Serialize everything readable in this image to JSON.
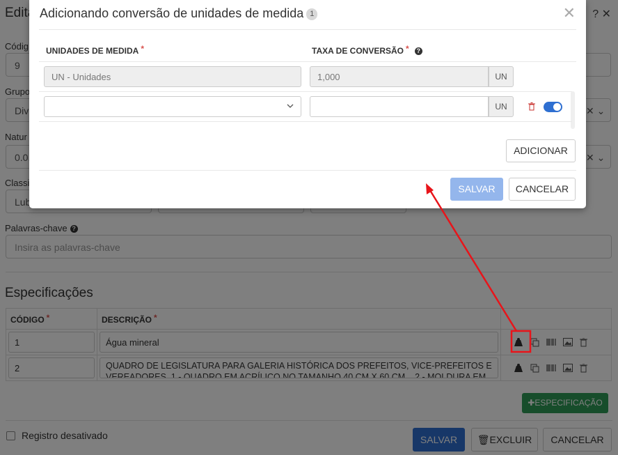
{
  "background": {
    "title": "Edita",
    "labels": {
      "codigo": "Códig",
      "grupo": "Grupo",
      "natureza": "Natur",
      "classificacao": "Classi",
      "palavras": "Palavras-chave"
    },
    "values": {
      "codigo": "9",
      "grupo": "Dive",
      "natureza": "0.0.",
      "classificacao": "Lub"
    },
    "palavras_placeholder": "Insira as palavras-chave",
    "specs_title": "Especificações",
    "table": {
      "headers": [
        "CÓDIGO",
        "DESCRIÇÃO"
      ],
      "rows": [
        {
          "codigo": "1",
          "descricao": "Água mineral"
        },
        {
          "codigo": "2",
          "descricao": "QUADRO DE LEGISLATURA PARA GALERIA HISTÓRICA DOS PREFEITOS, VICE-PREFEITOS E VEREADORES. 1 - QUADRO EM ACRÍLICO NO TAMANHO 40 CM X 60 CM... 2 - MOLDURA EM"
        }
      ]
    },
    "add_spec_label": "ESPECIFICAÇÃO",
    "checkbox_label": "Registro desativado",
    "buttons": {
      "save": "SALVAR",
      "delete": "EXCLUIR",
      "cancel": "CANCELAR"
    }
  },
  "modal": {
    "title": "Adicionando conversão de unidades de medida",
    "badge": "1",
    "columns": {
      "unit": "UNIDADES DE MEDIDA",
      "rate": "TAXA DE CONVERSÃO"
    },
    "rows": [
      {
        "unit_value": "UN - Unidades",
        "rate_value": "1,000",
        "suffix": "UN"
      },
      {
        "unit_value": "",
        "rate_value": "",
        "suffix": "UN"
      }
    ],
    "add_label": "ADICIONAR",
    "save_label": "SALVAR",
    "cancel_label": "CANCELAR"
  },
  "colors": {
    "primary": "#2e6fd1",
    "success": "#2e9b57",
    "danger": "#d9534f",
    "annotation": "#e8141a"
  }
}
